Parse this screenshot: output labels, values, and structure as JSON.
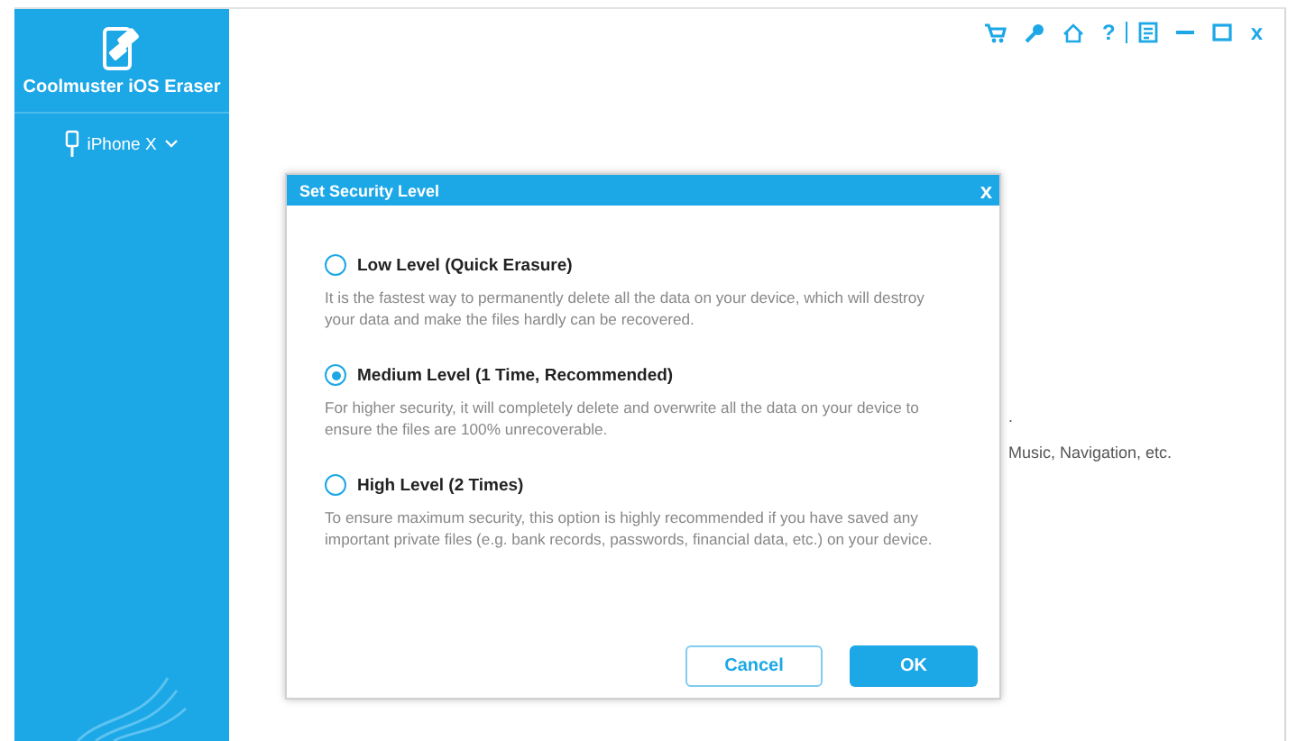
{
  "sidebar": {
    "app_name": "Coolmuster iOS Eraser",
    "device": "iPhone X"
  },
  "toolbar": {
    "help": "?",
    "close": "x"
  },
  "background_text": [
    ".",
    "Music, Navigation, etc."
  ],
  "dialog": {
    "title": "Set Security Level",
    "close": "x",
    "options": [
      {
        "label": "Low Level (Quick Erasure)",
        "description": "It is the fastest way to permanently delete all the data on your device, which will destroy your data and make the files hardly can be recovered.",
        "selected": false
      },
      {
        "label": "Medium Level (1 Time, Recommended)",
        "description": "For higher security, it will completely delete and overwrite all the data on your device to ensure the files are 100% unrecoverable.",
        "selected": true
      },
      {
        "label": "High Level (2 Times)",
        "description": "To ensure maximum security, this option is highly recommended if you have saved any important private files (e.g. bank records, passwords, financial data, etc.) on your device.",
        "selected": false
      }
    ],
    "buttons": [
      {
        "label": "Cancel",
        "kind": "secondary"
      },
      {
        "label": "OK",
        "kind": "primary"
      }
    ]
  }
}
